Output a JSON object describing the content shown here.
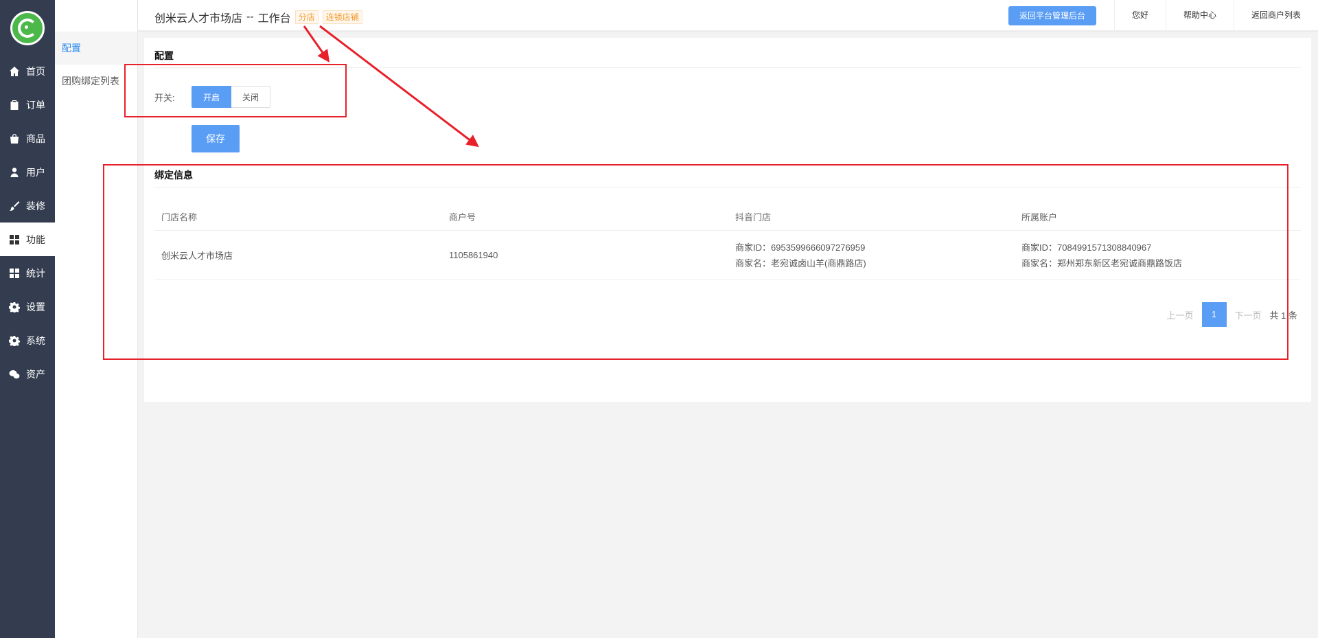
{
  "nav": {
    "items": [
      {
        "label": "首页",
        "icon": "home-icon"
      },
      {
        "label": "订单",
        "icon": "clipboard-icon"
      },
      {
        "label": "商品",
        "icon": "bag-icon"
      },
      {
        "label": "用户",
        "icon": "user-icon"
      },
      {
        "label": "装修",
        "icon": "brush-icon"
      },
      {
        "label": "功能",
        "icon": "grid-icon",
        "active": true
      },
      {
        "label": "统计",
        "icon": "grid-icon"
      },
      {
        "label": "设置",
        "icon": "gear-icon"
      },
      {
        "label": "系统",
        "icon": "gear-icon"
      },
      {
        "label": "资产",
        "icon": "wechat-icon"
      }
    ]
  },
  "subnav": {
    "items": [
      {
        "label": "配置",
        "active": true
      },
      {
        "label": "团购绑定列表"
      }
    ]
  },
  "header": {
    "shop_name": "创米云人才市场店",
    "separator": "--",
    "workspace": "工作台",
    "tag_branch": "分店",
    "tag_chain": "连锁店铺",
    "back_platform": "返回平台管理后台",
    "greeting": "您好",
    "help": "帮助中心",
    "back_merchants": "返回商户列表"
  },
  "config": {
    "title": "配置",
    "switch_label": "开关:",
    "on_label": "开启",
    "off_label": "关闭",
    "save_label": "保存"
  },
  "binding": {
    "title": "绑定信息",
    "columns": [
      "门店名称",
      "商户号",
      "抖音门店",
      "所属账户"
    ],
    "rows": [
      {
        "store_name": "创米云人才市场店",
        "merchant_no": "1105861940",
        "douyin_id": "商家ID：6953599666097276959",
        "douyin_name": "商家名：老宛诚卤山羊(商鼎路店)",
        "account_id": "商家ID：7084991571308840967",
        "account_name": "商家名：郑州郑东新区老宛诚商鼎路饭店"
      }
    ]
  },
  "pager": {
    "prev": "上一页",
    "current": "1",
    "next": "下一页",
    "total": "共 1 条"
  },
  "colors": {
    "accent": "#5a9df5",
    "nav_bg": "#333d4f",
    "annotation": "#e8202a",
    "tag": "#f39a2a"
  }
}
